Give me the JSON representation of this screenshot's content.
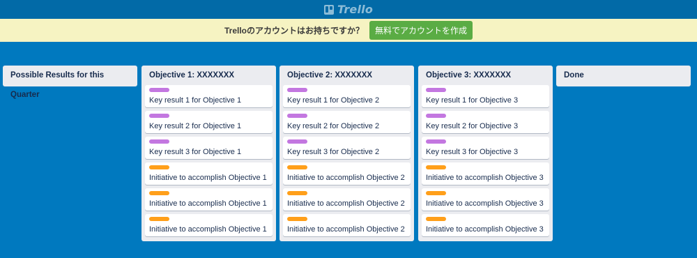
{
  "app": {
    "logo_text": "Trello",
    "logo_icon": "trello-board-icon"
  },
  "banner": {
    "text": "Trelloのアカウントはお持ちですか？",
    "button_label": "無料でアカウントを作成",
    "button_color": "#5aac44"
  },
  "colors": {
    "board_background": "#0079bf",
    "header_background": "#026aa7",
    "label_purple": "#c377e0",
    "label_orange": "#ff9f1a"
  },
  "lists": [
    {
      "title": "Possible Results for this Quarter",
      "cards": []
    },
    {
      "title": "Objective 1: XXXXXXX",
      "cards": [
        {
          "label_color": "#c377e0",
          "title": "Key result 1 for Objective 1"
        },
        {
          "label_color": "#c377e0",
          "title": "Key result 2 for Objective 1"
        },
        {
          "label_color": "#c377e0",
          "title": "Key result 3 for Objective 1"
        },
        {
          "label_color": "#ff9f1a",
          "title": "Initiative to accomplish Objective 1"
        },
        {
          "label_color": "#ff9f1a",
          "title": "Initiative to accomplish Objective 1"
        },
        {
          "label_color": "#ff9f1a",
          "title": "Initiative to accomplish Objective 1"
        }
      ]
    },
    {
      "title": "Objective 2: XXXXXXX",
      "cards": [
        {
          "label_color": "#c377e0",
          "title": "Key result 1 for Objective 2"
        },
        {
          "label_color": "#c377e0",
          "title": "Key result 2 for Objective 2"
        },
        {
          "label_color": "#c377e0",
          "title": "Key result 3 for Objective 2"
        },
        {
          "label_color": "#ff9f1a",
          "title": "Initiative to accomplish Objective 2"
        },
        {
          "label_color": "#ff9f1a",
          "title": "Initiative to accomplish Objective 2"
        },
        {
          "label_color": "#ff9f1a",
          "title": "Initiative to accomplish Objective 2"
        }
      ]
    },
    {
      "title": "Objective 3: XXXXXXX",
      "cards": [
        {
          "label_color": "#c377e0",
          "title": "Key result 1 for Objective 3"
        },
        {
          "label_color": "#c377e0",
          "title": "Key result 2 for Objective 3"
        },
        {
          "label_color": "#c377e0",
          "title": "Key result 3 for Objective 3"
        },
        {
          "label_color": "#ff9f1a",
          "title": "Initiative to accomplish Objective 3"
        },
        {
          "label_color": "#ff9f1a",
          "title": "Initiative to accomplish Objective 3"
        },
        {
          "label_color": "#ff9f1a",
          "title": "Initiative to accomplish Objective 3"
        }
      ]
    },
    {
      "title": "Done",
      "cards": []
    }
  ]
}
